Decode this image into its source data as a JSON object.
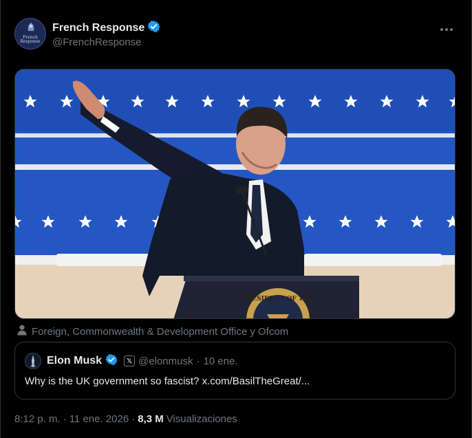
{
  "post": {
    "author": {
      "display_name": "French Response",
      "handle": "@FrenchResponse",
      "verified": true,
      "avatar_text": "French Response"
    },
    "more_icon": "more-horizontal-icon",
    "media": {
      "alt_subject": "man in dark suit raising right arm at podium with presidential seal",
      "seal_text": "PRESIDENT OF THE",
      "background_colors": {
        "banner": "#2457c4",
        "stars": "#ffffff",
        "base": "#e6d2bb"
      }
    },
    "attribution": {
      "icon": "person-icon",
      "text": "Foreign, Commonwealth & Development Office y Ofcom"
    },
    "quoted_post": {
      "display_name": "Elon Musk",
      "verified": true,
      "affiliate_badge": "𝕏",
      "handle": "@elonmusk",
      "separator": "·",
      "date": "10 ene.",
      "text": "Why is the UK government so fascist? x.com/BasilTheGreat/..."
    },
    "meta": {
      "time": "8:12 p. m.",
      "separator1": "·",
      "date": "11 ene. 2026",
      "separator2": "·",
      "views_count": "8,3 M",
      "views_label": "Visualizaciones"
    }
  },
  "colors": {
    "background": "#000000",
    "text_primary": "#e7e9ea",
    "text_secondary": "#71767b",
    "border": "#2f3336",
    "verified_blue": "#1d9bf0"
  }
}
